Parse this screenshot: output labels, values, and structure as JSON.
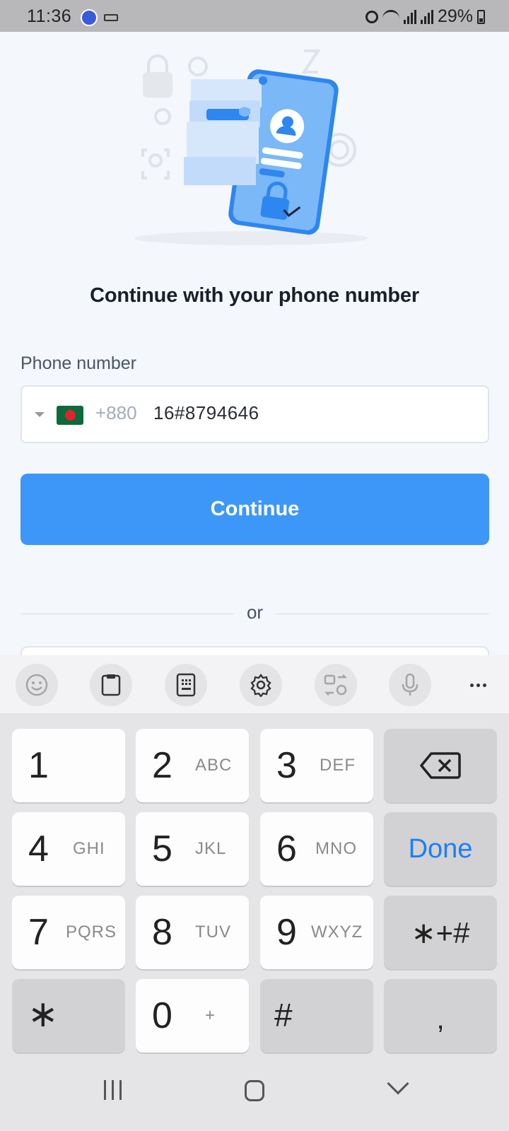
{
  "status_bar": {
    "time": "11:36",
    "battery": "29%"
  },
  "headline": "Continue with your phone number",
  "form": {
    "phone_label": "Phone number",
    "country_code": "+880",
    "phone_value": "16#8794646",
    "continue_label": "Continue",
    "divider_text": "or"
  },
  "keyboard": {
    "keys": [
      {
        "num": "1",
        "sub": ""
      },
      {
        "num": "2",
        "sub": "ABC"
      },
      {
        "num": "3",
        "sub": "DEF"
      },
      {
        "num": "4",
        "sub": "GHI"
      },
      {
        "num": "5",
        "sub": "JKL"
      },
      {
        "num": "6",
        "sub": "MNO"
      },
      {
        "num": "7",
        "sub": "PQRS"
      },
      {
        "num": "8",
        "sub": "TUV"
      },
      {
        "num": "9",
        "sub": "WXYZ"
      },
      {
        "num": "0",
        "sub": "+"
      }
    ],
    "done_label": "Done",
    "symbols_label": "∗+#",
    "star_label": "∗",
    "hash_label": "#",
    "comma_label": ","
  },
  "colors": {
    "accent": "#3d97f9",
    "done_text": "#1e7ef5",
    "flag_green": "#0c6a3b",
    "flag_red": "#e2222f"
  },
  "icons": [
    "alarm-icon",
    "wifi-icon",
    "signal-icon",
    "battery-icon",
    "emoji-icon",
    "clipboard-icon",
    "keyboard-mode-icon",
    "settings-icon",
    "translate-icon",
    "mic-icon",
    "more-icon",
    "backspace-icon"
  ]
}
